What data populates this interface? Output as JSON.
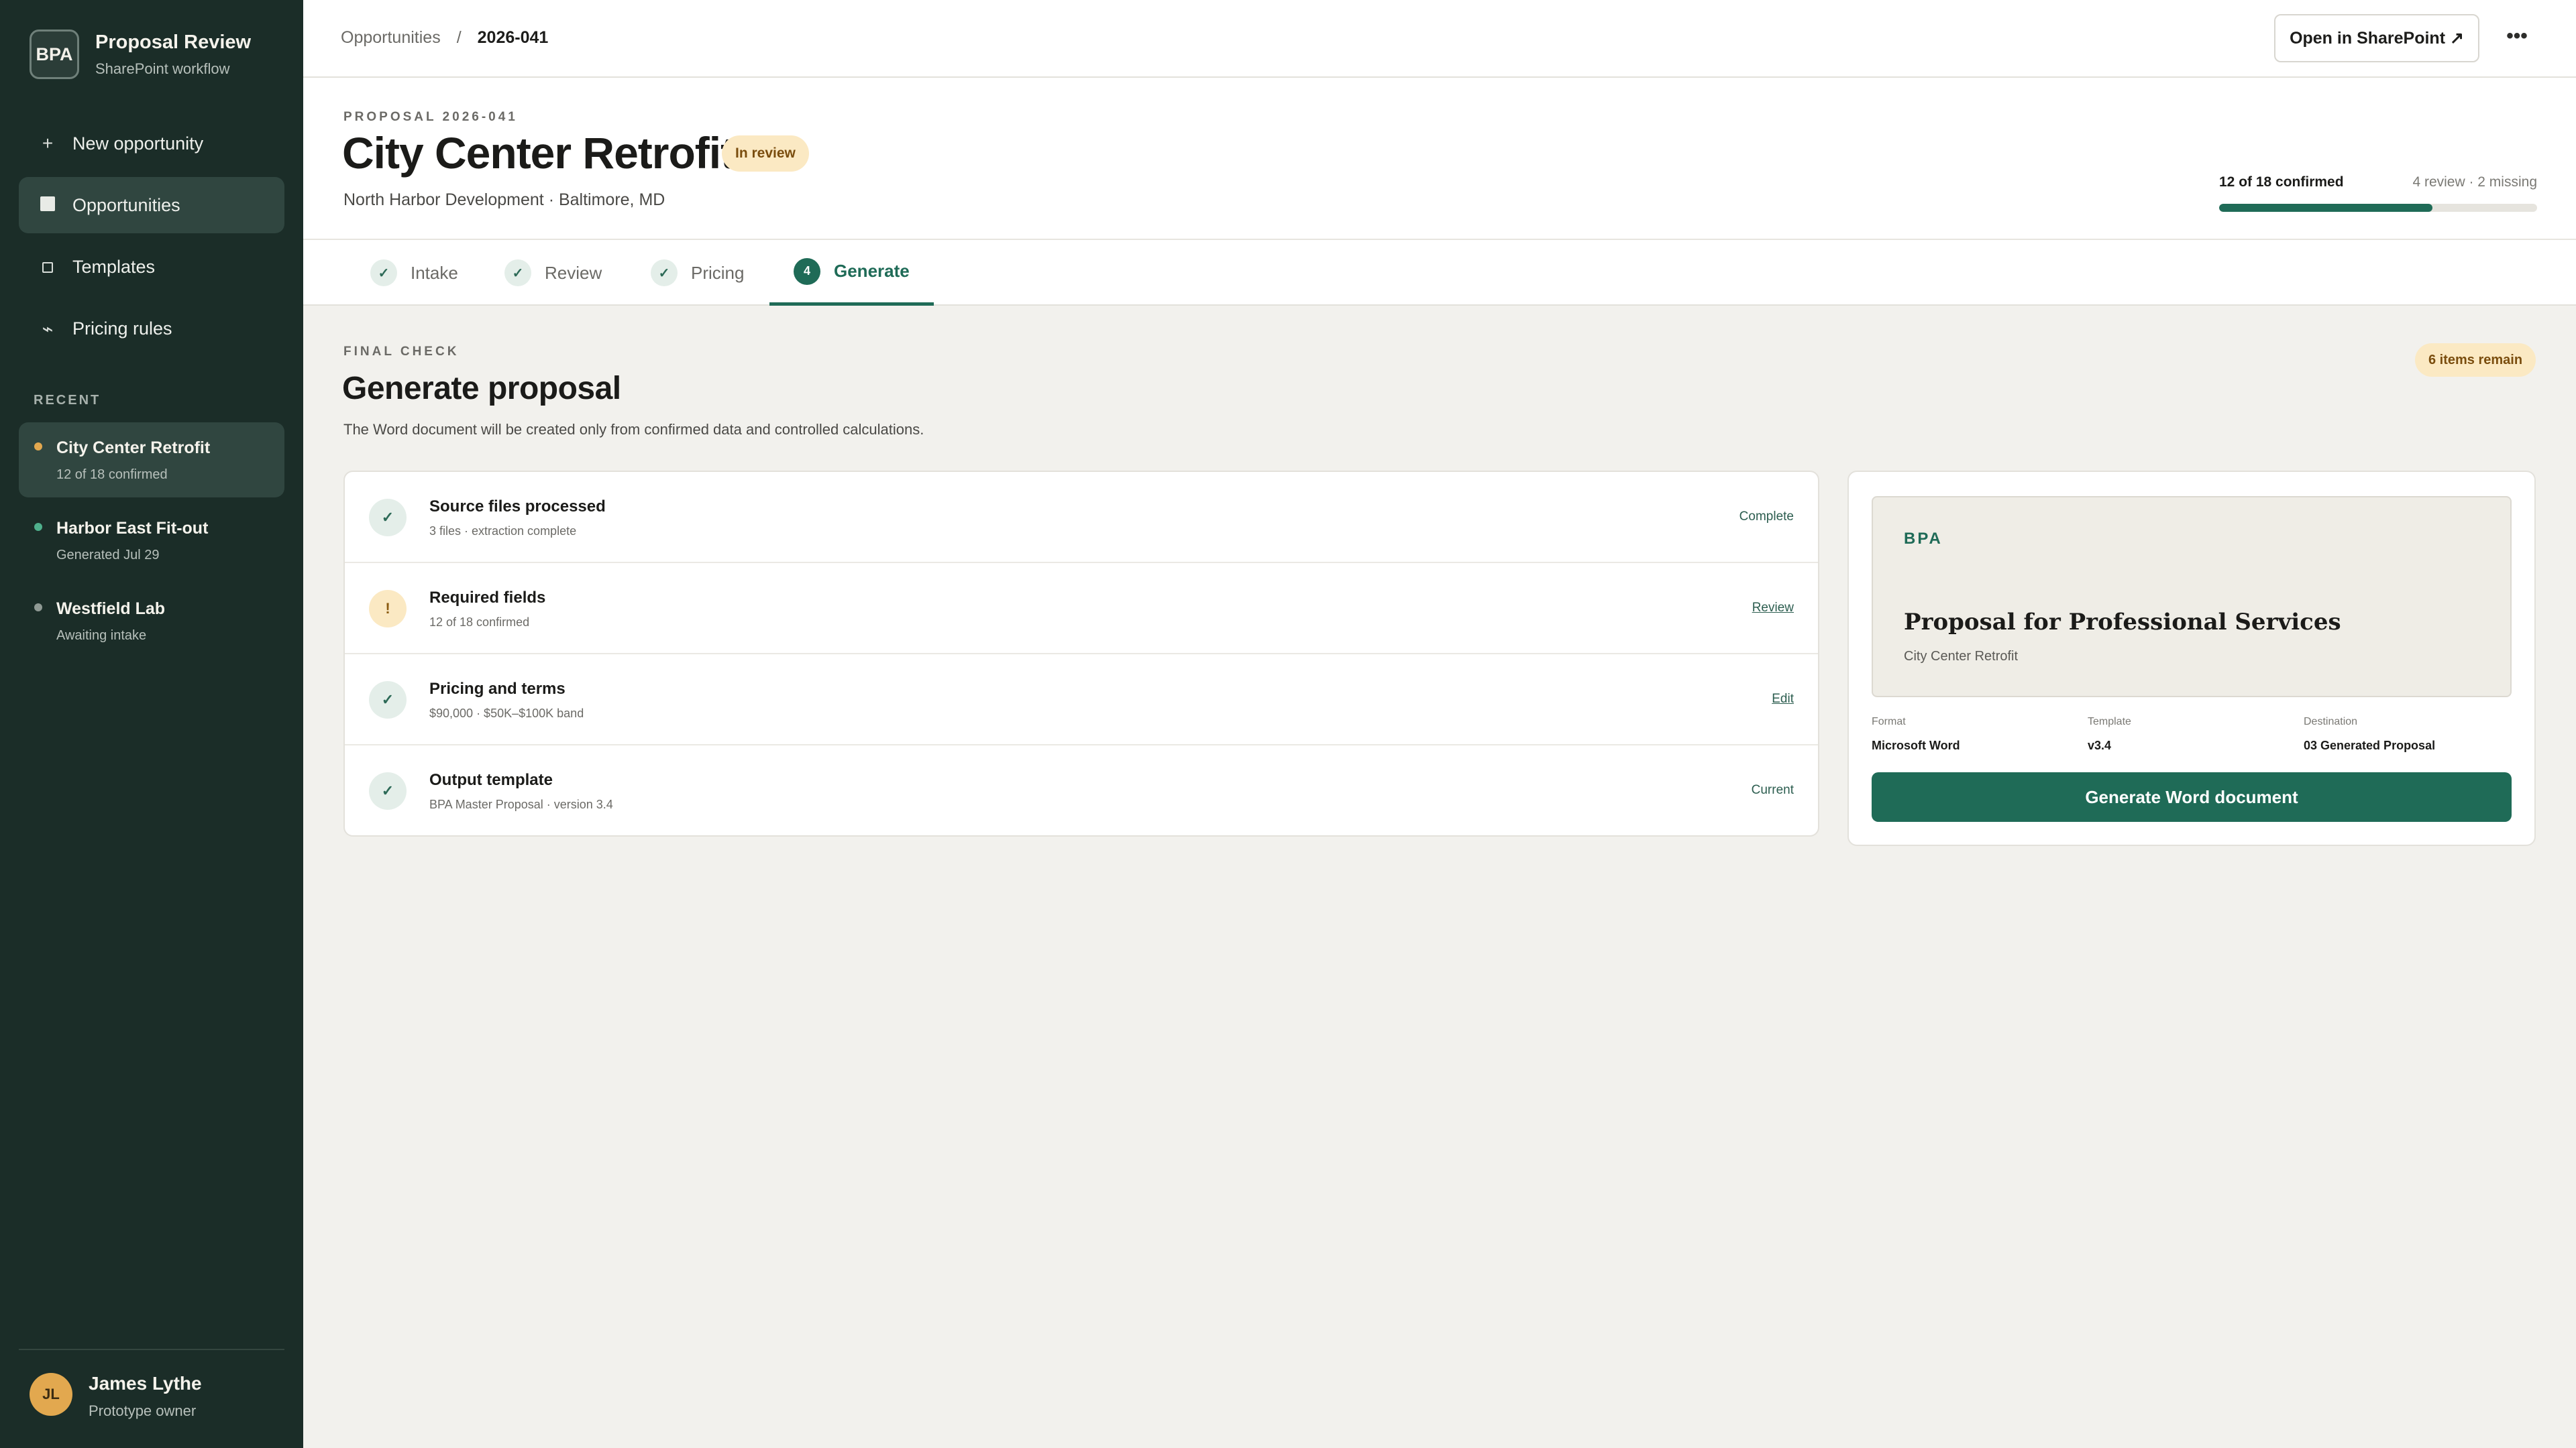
{
  "app": {
    "logo": "BPA",
    "title": "Proposal Review",
    "subtitle": "SharePoint workflow"
  },
  "nav": {
    "items": [
      {
        "label": "New opportunity",
        "icon": "plus-icon",
        "glyph": "+"
      },
      {
        "label": "Opportunities",
        "icon": "grid-square-icon",
        "active": true
      },
      {
        "label": "Templates",
        "icon": "document-square-icon"
      },
      {
        "label": "Pricing rules",
        "icon": "rules-icon",
        "glyph": "⌁"
      }
    ]
  },
  "recent": {
    "label": "RECENT",
    "items": [
      {
        "title": "City Center Retrofit",
        "sub": "12 of 18 confirmed",
        "color": "#e2a84f",
        "active": true
      },
      {
        "title": "Harbor East Fit-out",
        "sub": "Generated Jul 29",
        "color": "#4fb08c"
      },
      {
        "title": "Westfield Lab",
        "sub": "Awaiting intake",
        "color": "#8f9994"
      }
    ]
  },
  "user": {
    "initials": "JL",
    "name": "James Lythe",
    "role": "Prototype owner"
  },
  "breadcrumb": {
    "parent": "Opportunities",
    "sep": "/",
    "current": "2026-041"
  },
  "topbar": {
    "sharepoint_button": "Open in SharePoint ↗",
    "more": "•••"
  },
  "proposal": {
    "eyebrow": "PROPOSAL 2026-041",
    "title": "City Center Retrofit",
    "status": "In review",
    "client": "North Harbor Development · Baltimore, MD"
  },
  "progress": {
    "label": "12 of 18 confirmed",
    "meta": "4 review · 2 missing",
    "fraction": 0.67
  },
  "tabs": [
    {
      "label": "Intake",
      "marker": "✓"
    },
    {
      "label": "Review",
      "marker": "✓"
    },
    {
      "label": "Pricing",
      "marker": "✓"
    },
    {
      "label": "Generate",
      "marker": "4",
      "active": true
    }
  ],
  "final_check": {
    "eyebrow": "FINAL CHECK",
    "title": "Generate proposal",
    "description": "The Word document will be created only from confirmed data and controlled calculations.",
    "remain_badge": "6 items remain"
  },
  "checklist": [
    {
      "title": "Source files processed",
      "sub": "3 files · extraction complete",
      "action": "Complete",
      "state": "ok",
      "marker": "✓"
    },
    {
      "title": "Required fields",
      "sub": "12 of 18 confirmed",
      "action": "Review",
      "state": "warn",
      "marker": "!"
    },
    {
      "title": "Pricing and terms",
      "sub": "$90,000 · $50K–$100K band",
      "action": "Edit",
      "state": "ok",
      "marker": "✓"
    },
    {
      "title": "Output template",
      "sub": "BPA Master Proposal · version 3.4",
      "action": "Current",
      "state": "ok",
      "marker": "✓"
    }
  ],
  "generate": {
    "preview_brand": "BPA",
    "preview_title": "Proposal for Professional Services",
    "preview_sub": "City Center Retrofit",
    "meta": [
      {
        "label": "Format",
        "value": "Microsoft Word"
      },
      {
        "label": "Template",
        "value": "v3.4"
      },
      {
        "label": "Destination",
        "value": "03 Generated Proposal"
      }
    ],
    "button": "Generate Word document"
  },
  "colors": {
    "sidebar": "#1b2d28",
    "accent": "#1f6b57",
    "warning": "#fbe9c3",
    "background": "#f2f1ed"
  }
}
